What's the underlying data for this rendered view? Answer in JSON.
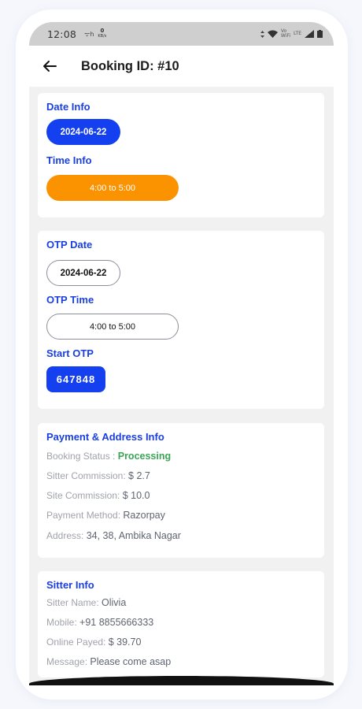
{
  "status_bar": {
    "time": "12:08",
    "network_speed": "0",
    "network_unit": "KB/s",
    "wifi_label": "Vo",
    "wifi_sub": "WiFi",
    "lte_label": "LTE"
  },
  "header": {
    "title": "Booking ID: #10"
  },
  "date_card": {
    "date_label": "Date Info",
    "date_value": "2024-06-22",
    "time_label": "Time Info",
    "time_value": "4:00 to 5:00"
  },
  "otp_card": {
    "otp_date_label": "OTP Date",
    "otp_date_value": "2024-06-22",
    "otp_time_label": "OTP Time",
    "otp_time_value": "4:00 to 5:00",
    "start_otp_label": "Start OTP",
    "start_otp_value": "647848"
  },
  "payment_card": {
    "title": "Payment & Address Info",
    "booking_status_label": "Booking Status : ",
    "booking_status_value": "Processing",
    "sitter_commission_label": "Sitter Commission: ",
    "sitter_commission_value": "$ 2.7",
    "site_commission_label": "Site Commission: ",
    "site_commission_value": "$ 10.0",
    "payment_method_label": "Payment Method: ",
    "payment_method_value": "Razorpay",
    "address_label": "Address: ",
    "address_value": "34, 38, Ambika Nagar"
  },
  "sitter_card": {
    "title": "Sitter Info",
    "name_label": "Sitter Name: ",
    "name_value": "Olivia",
    "mobile_label": "Mobile: ",
    "mobile_value": "+91 8855666333",
    "online_payed_label": "Online Payed: ",
    "online_payed_value": "$ 39.70",
    "message_label": "Message: ",
    "message_value": "Please come asap"
  },
  "colors": {
    "accent_blue": "#1540f0",
    "label_blue": "#1a3fe0",
    "orange": "#fb9300",
    "status_green": "#3aa655"
  }
}
